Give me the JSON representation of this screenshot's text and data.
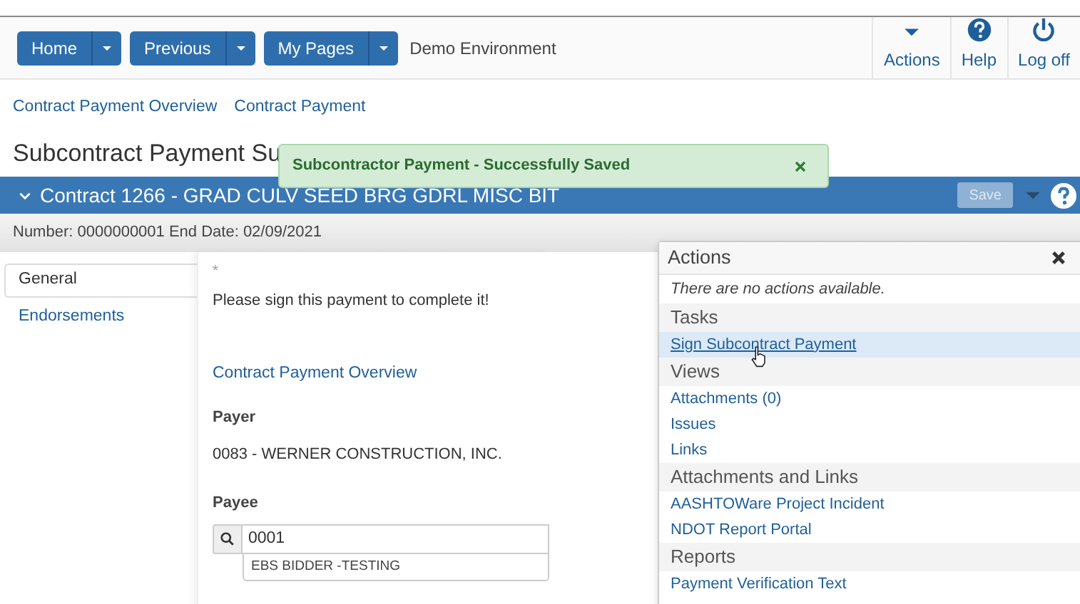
{
  "nav": {
    "buttons": [
      {
        "label": "Home"
      },
      {
        "label": "Previous"
      },
      {
        "label": "My Pages"
      }
    ],
    "environment": "Demo Environment",
    "tools": [
      {
        "kind": "actions",
        "label": "Actions"
      },
      {
        "kind": "help",
        "label": "Help"
      },
      {
        "kind": "logoff",
        "label": "Log off"
      }
    ]
  },
  "breadcrumbs": [
    "Contract Payment Overview",
    "Contract Payment"
  ],
  "page_title": "Subcontract Payment Su",
  "toast": {
    "message": "Subcontractor Payment - Successfully Saved"
  },
  "contract_bar": {
    "title": "Contract 1266 - GRAD CULV SEED BRG GDRL MISC BIT",
    "expanded": true,
    "save_label": "Save",
    "save_disabled": true
  },
  "info_bar": "Number: 0000000001 End Date: 02/09/2021",
  "tabs": [
    {
      "label": "General",
      "selected": true
    },
    {
      "label": "Endorsements",
      "selected": false
    }
  ],
  "form": {
    "required_mark": "*",
    "instruction": "Please sign this payment to complete it!",
    "link": "Contract Payment Overview",
    "payer_label": "Payer",
    "payer_value": "0083 - WERNER CONSTRUCTION, INC.",
    "payee_label": "Payee",
    "payee_value": "0001",
    "payee_suggestion": "EBS BIDDER -TESTING"
  },
  "actions_panel": {
    "title": "Actions",
    "empty_note": "There are no actions available.",
    "sections": [
      {
        "title": "Tasks",
        "items": [
          {
            "label": "Sign Subcontract Payment",
            "selected": true
          }
        ]
      },
      {
        "title": "Views",
        "items": [
          {
            "label": "Attachments (0)",
            "selected": false
          },
          {
            "label": "Issues",
            "selected": false
          },
          {
            "label": "Links",
            "selected": false
          }
        ]
      },
      {
        "title": "Attachments and Links",
        "items": [
          {
            "label": "AASHTOWare Project Incident",
            "selected": false
          },
          {
            "label": "NDOT Report Portal",
            "selected": false
          }
        ]
      },
      {
        "title": "Reports",
        "items": [
          {
            "label": "Payment Verification Text",
            "selected": false
          }
        ]
      }
    ]
  }
}
